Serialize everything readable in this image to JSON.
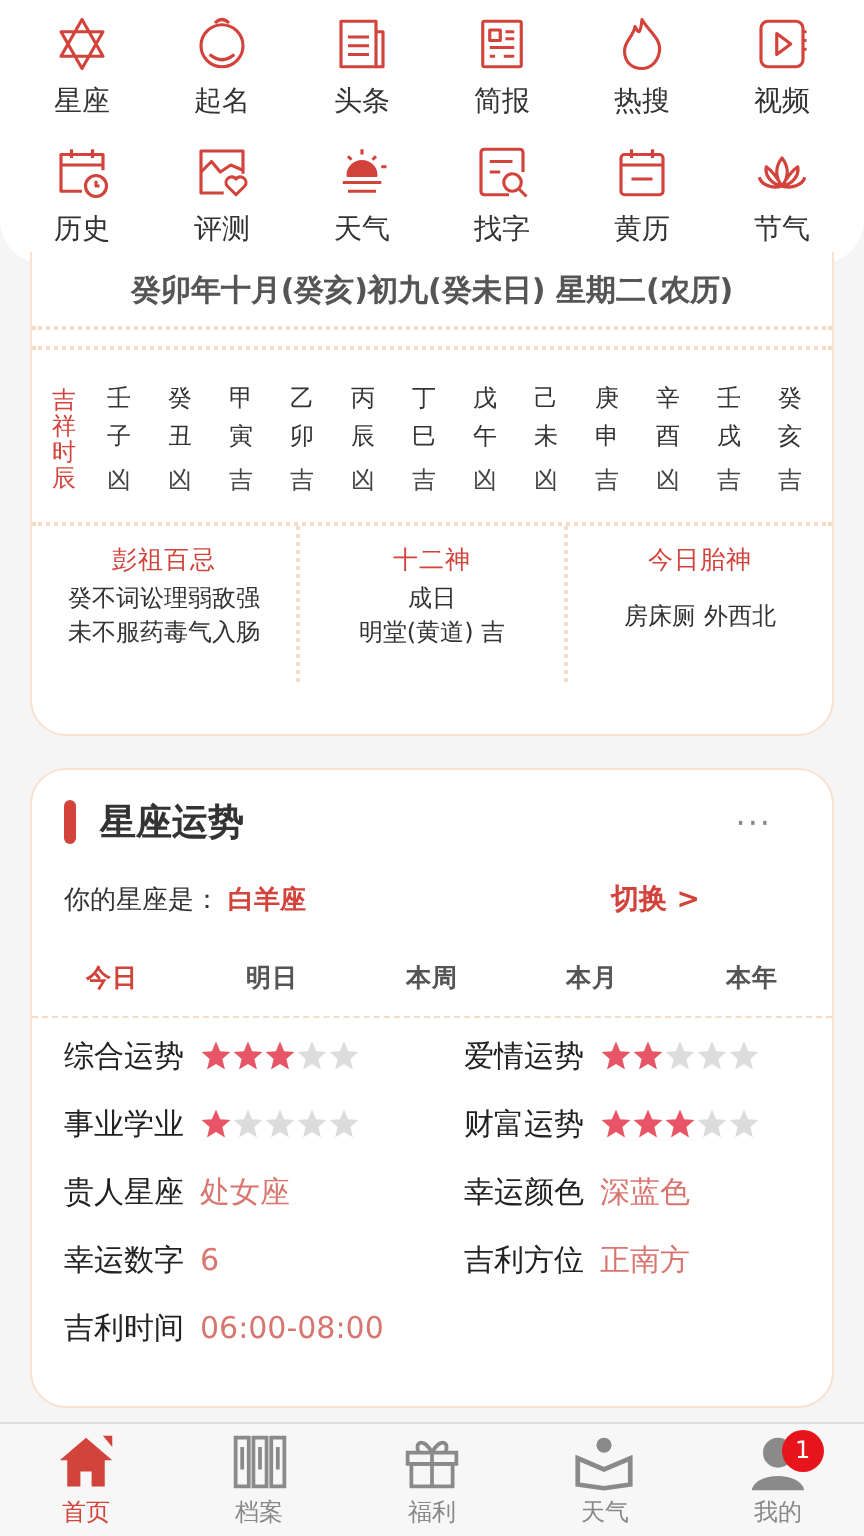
{
  "shortcuts": [
    {
      "label": "星座"
    },
    {
      "label": "起名"
    },
    {
      "label": "头条"
    },
    {
      "label": "简报"
    },
    {
      "label": "热搜"
    },
    {
      "label": "视频"
    },
    {
      "label": "历史"
    },
    {
      "label": "评测"
    },
    {
      "label": "天气"
    },
    {
      "label": "找字"
    },
    {
      "label": "黄历"
    },
    {
      "label": "节气"
    }
  ],
  "almanac": {
    "lunar_date": "癸卯年十月(癸亥)初九(癸未日) 星期二(农历)",
    "hours_label": "吉祥时辰",
    "hours": [
      {
        "stem": "壬",
        "branch": "子",
        "luck": "凶"
      },
      {
        "stem": "癸",
        "branch": "丑",
        "luck": "凶"
      },
      {
        "stem": "甲",
        "branch": "寅",
        "luck": "吉"
      },
      {
        "stem": "乙",
        "branch": "卯",
        "luck": "吉"
      },
      {
        "stem": "丙",
        "branch": "辰",
        "luck": "凶"
      },
      {
        "stem": "丁",
        "branch": "巳",
        "luck": "吉"
      },
      {
        "stem": "戊",
        "branch": "午",
        "luck": "凶"
      },
      {
        "stem": "己",
        "branch": "未",
        "luck": "凶"
      },
      {
        "stem": "庚",
        "branch": "申",
        "luck": "吉"
      },
      {
        "stem": "辛",
        "branch": "酉",
        "luck": "凶"
      },
      {
        "stem": "壬",
        "branch": "戌",
        "luck": "吉"
      },
      {
        "stem": "癸",
        "branch": "亥",
        "luck": "吉"
      }
    ],
    "sections": [
      {
        "title": "彭祖百忌",
        "lines": [
          "癸不词讼理弱敌强",
          "未不服药毒气入肠"
        ]
      },
      {
        "title": "十二神",
        "lines": [
          "成日",
          "明堂(黄道) 吉"
        ]
      },
      {
        "title": "今日胎神",
        "lines": [
          "房床厕 外西北"
        ]
      }
    ]
  },
  "horoscope": {
    "title": "星座运势",
    "more": "···",
    "sign_label": "你的星座是：",
    "sign": "白羊座",
    "switch": "切换 >",
    "tabs": [
      {
        "label": "今日",
        "selected": true
      },
      {
        "label": "明日",
        "selected": false
      },
      {
        "label": "本周",
        "selected": false
      },
      {
        "label": "本月",
        "selected": false
      },
      {
        "label": "本年",
        "selected": false
      }
    ],
    "items": [
      {
        "kind": "rating",
        "label": "综合运势",
        "stars": 3
      },
      {
        "kind": "rating",
        "label": "爱情运势",
        "stars": 2
      },
      {
        "kind": "rating",
        "label": "事业学业",
        "stars": 1
      },
      {
        "kind": "rating",
        "label": "财富运势",
        "stars": 3
      },
      {
        "kind": "text",
        "label": "贵人星座",
        "value": "处女座"
      },
      {
        "kind": "text",
        "label": "幸运颜色",
        "value": "深蓝色"
      },
      {
        "kind": "text",
        "label": "幸运数字",
        "value": "6"
      },
      {
        "kind": "text",
        "label": "吉利方位",
        "value": "正南方"
      },
      {
        "kind": "text",
        "label": "吉利时间",
        "value": "06:00-08:00"
      }
    ]
  },
  "tab_bar": [
    {
      "label": "首页",
      "selected": true
    },
    {
      "label": "档案",
      "selected": false
    },
    {
      "label": "福利",
      "selected": false
    },
    {
      "label": "天气",
      "selected": false
    },
    {
      "label": "我的",
      "selected": false,
      "badge": "1"
    }
  ]
}
